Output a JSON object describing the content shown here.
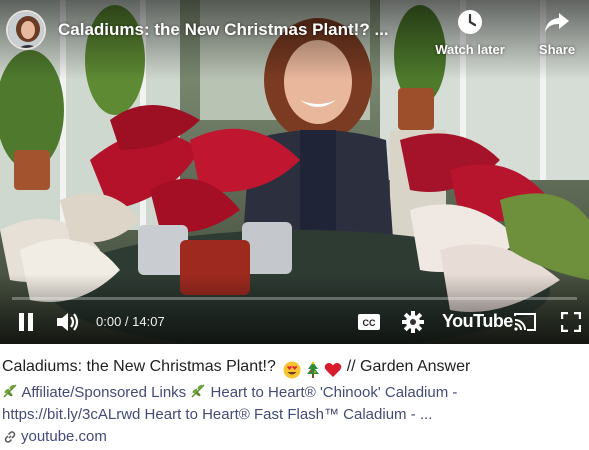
{
  "video": {
    "title": "Caladiums: the New Christmas Plant!? ...",
    "watch_later_label": "Watch later",
    "share_label": "Share",
    "time_display": "0:00 / 14:07",
    "progress_fraction": 0,
    "brand_label": "YouTube"
  },
  "preview": {
    "title": "Caladiums: the New Christmas Plant!?",
    "title_suffix": "// Garden Answer",
    "title_emoji_icons": [
      "heart-eyes-emoji-icon",
      "christmas-tree-emoji-icon",
      "red-heart-emoji-icon"
    ],
    "desc_line1_text": "Affiliate/Sponsored Links",
    "desc_line1_rest": "Heart to Heart® 'Chinook' Caladium -",
    "desc_line2": "https://bit.ly/3cALrwd Heart to Heart® Fast Flash™ Caladium - ...",
    "source": "youtube.com"
  },
  "colors": {
    "progress_red": "#ff0000",
    "link_text": "#434b78",
    "title_text": "#1f1f1f"
  }
}
